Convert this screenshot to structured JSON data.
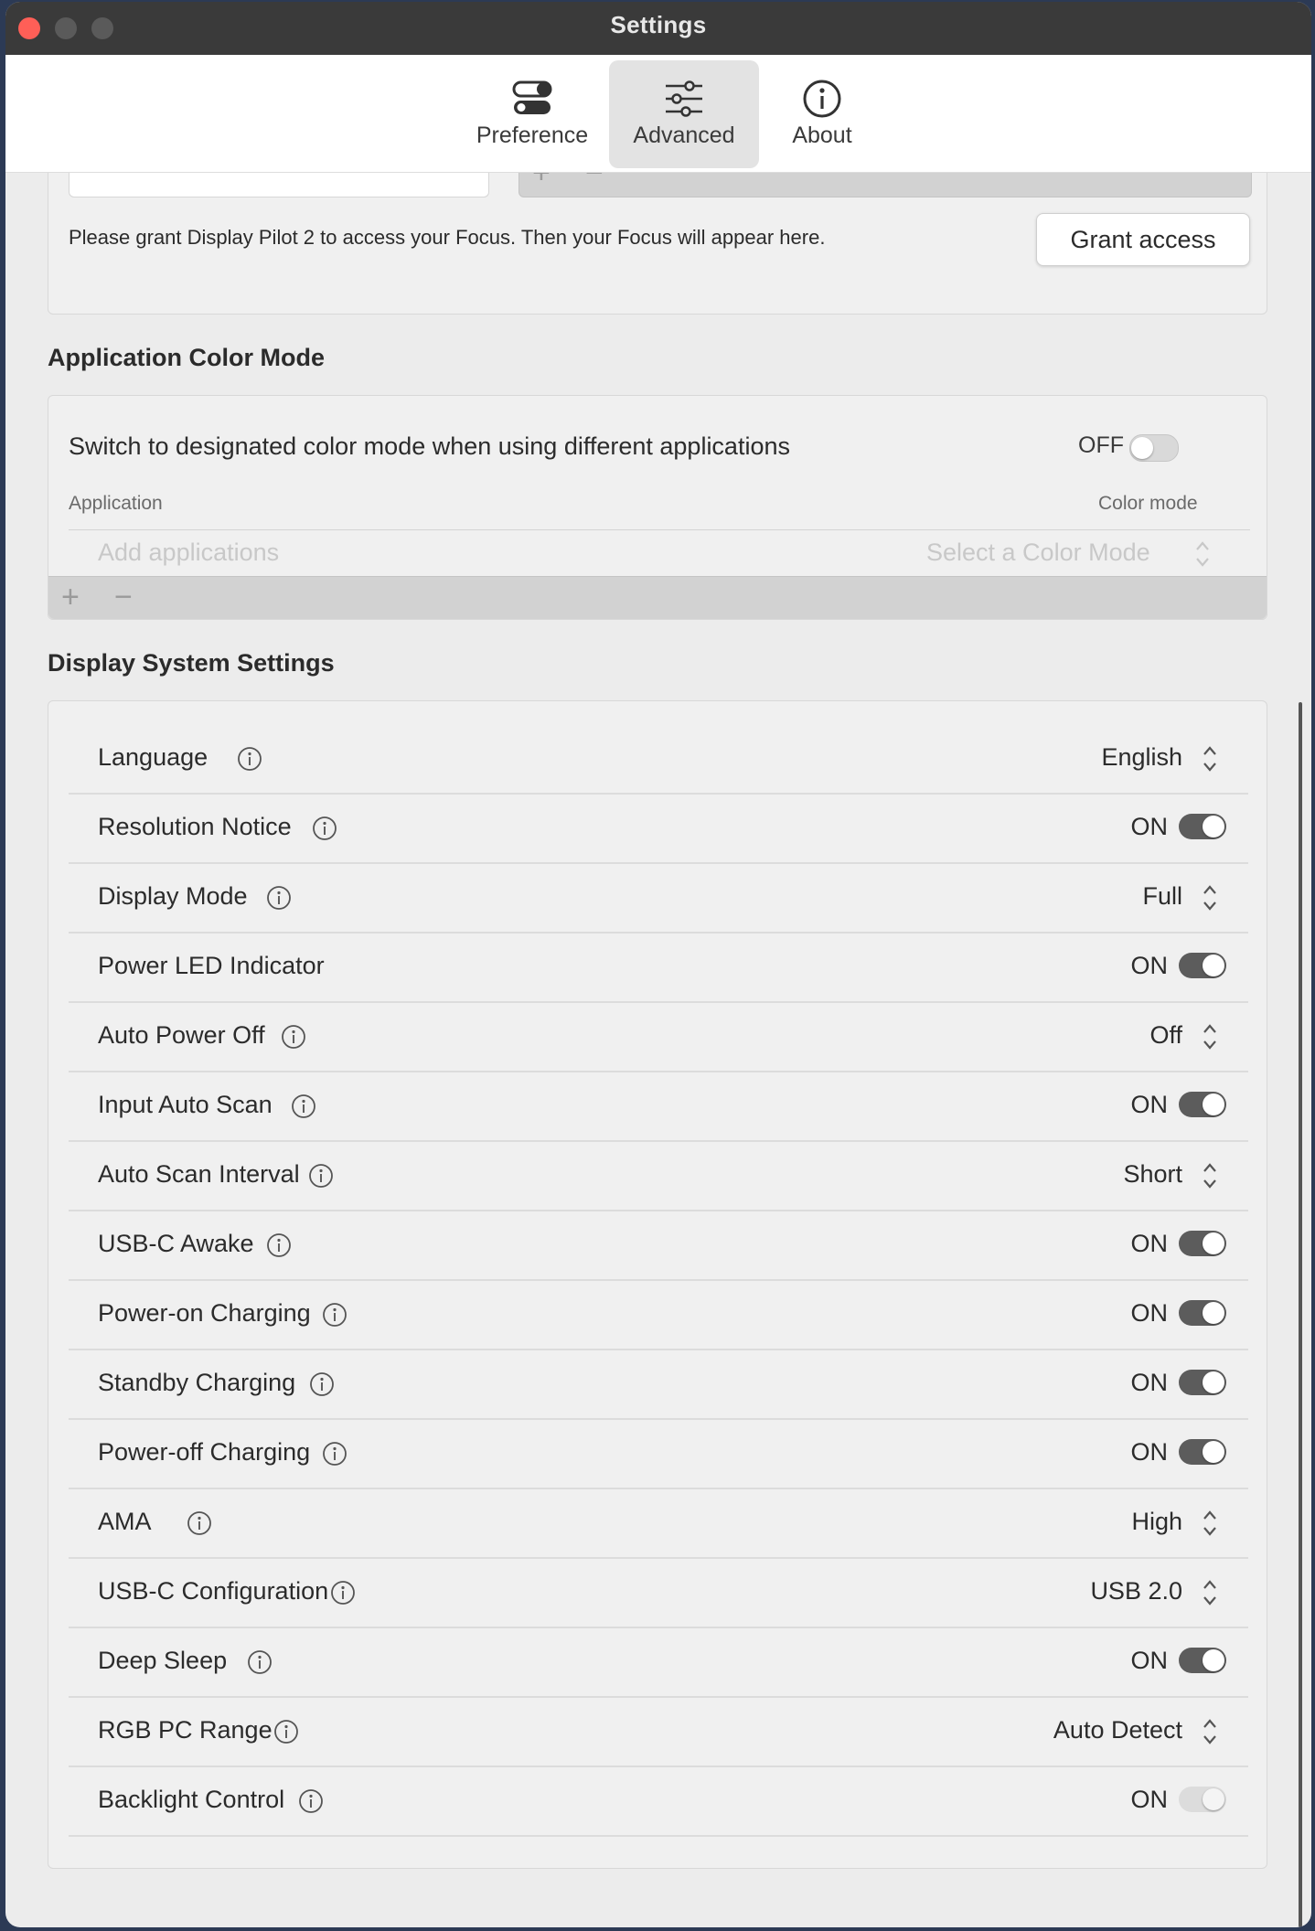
{
  "window": {
    "title": "Settings"
  },
  "tabs": [
    {
      "label": "Preference",
      "icon": "toggles-icon",
      "active": false
    },
    {
      "label": "Advanced",
      "icon": "sliders-icon",
      "active": true
    },
    {
      "label": "About",
      "icon": "info-circle-icon",
      "active": false
    }
  ],
  "focus": {
    "message": "Please grant Display Pilot 2 to access your Focus. Then your Focus will appear here.",
    "grant_button": "Grant access",
    "add": "+",
    "remove": "−"
  },
  "app_color_mode": {
    "title": "Application Color Mode",
    "switch_label": "Switch to designated color mode when using different applications",
    "switch_state": "OFF",
    "col_application": "Application",
    "col_color_mode": "Color mode",
    "add_placeholder": "Add applications",
    "select_placeholder": "Select a Color Mode",
    "add": "+",
    "remove": "−"
  },
  "display_settings": {
    "title": "Display System Settings",
    "rows": [
      {
        "label": "Language",
        "info": true,
        "type": "select",
        "value": "English"
      },
      {
        "label": "Resolution Notice",
        "info": true,
        "type": "toggle",
        "value": "ON",
        "state": "on"
      },
      {
        "label": "Display Mode",
        "info": true,
        "type": "select",
        "value": "Full"
      },
      {
        "label": "Power LED Indicator",
        "info": false,
        "type": "toggle",
        "value": "ON",
        "state": "on"
      },
      {
        "label": "Auto Power Off",
        "info": true,
        "type": "select",
        "value": "Off"
      },
      {
        "label": "Input Auto Scan",
        "info": true,
        "type": "toggle",
        "value": "ON",
        "state": "on"
      },
      {
        "label": "Auto Scan Interval",
        "info": true,
        "type": "select",
        "value": "Short"
      },
      {
        "label": "USB-C Awake",
        "info": true,
        "type": "toggle",
        "value": "ON",
        "state": "on"
      },
      {
        "label": "Power-on Charging",
        "info": true,
        "type": "toggle",
        "value": "ON",
        "state": "on"
      },
      {
        "label": "Standby Charging",
        "info": true,
        "type": "toggle",
        "value": "ON",
        "state": "on"
      },
      {
        "label": "Power-off Charging",
        "info": true,
        "type": "toggle",
        "value": "ON",
        "state": "on"
      },
      {
        "label": "AMA",
        "info": true,
        "type": "select",
        "value": "High"
      },
      {
        "label": "USB-C Configuration",
        "info": true,
        "type": "select",
        "value": "USB 2.0"
      },
      {
        "label": "Deep Sleep",
        "info": true,
        "type": "toggle",
        "value": "ON",
        "state": "on"
      },
      {
        "label": "RGB PC Range",
        "info": true,
        "type": "select",
        "value": "Auto Detect"
      },
      {
        "label": "Backlight Control",
        "info": true,
        "type": "toggle",
        "value": "ON",
        "state": "disabled"
      }
    ]
  }
}
